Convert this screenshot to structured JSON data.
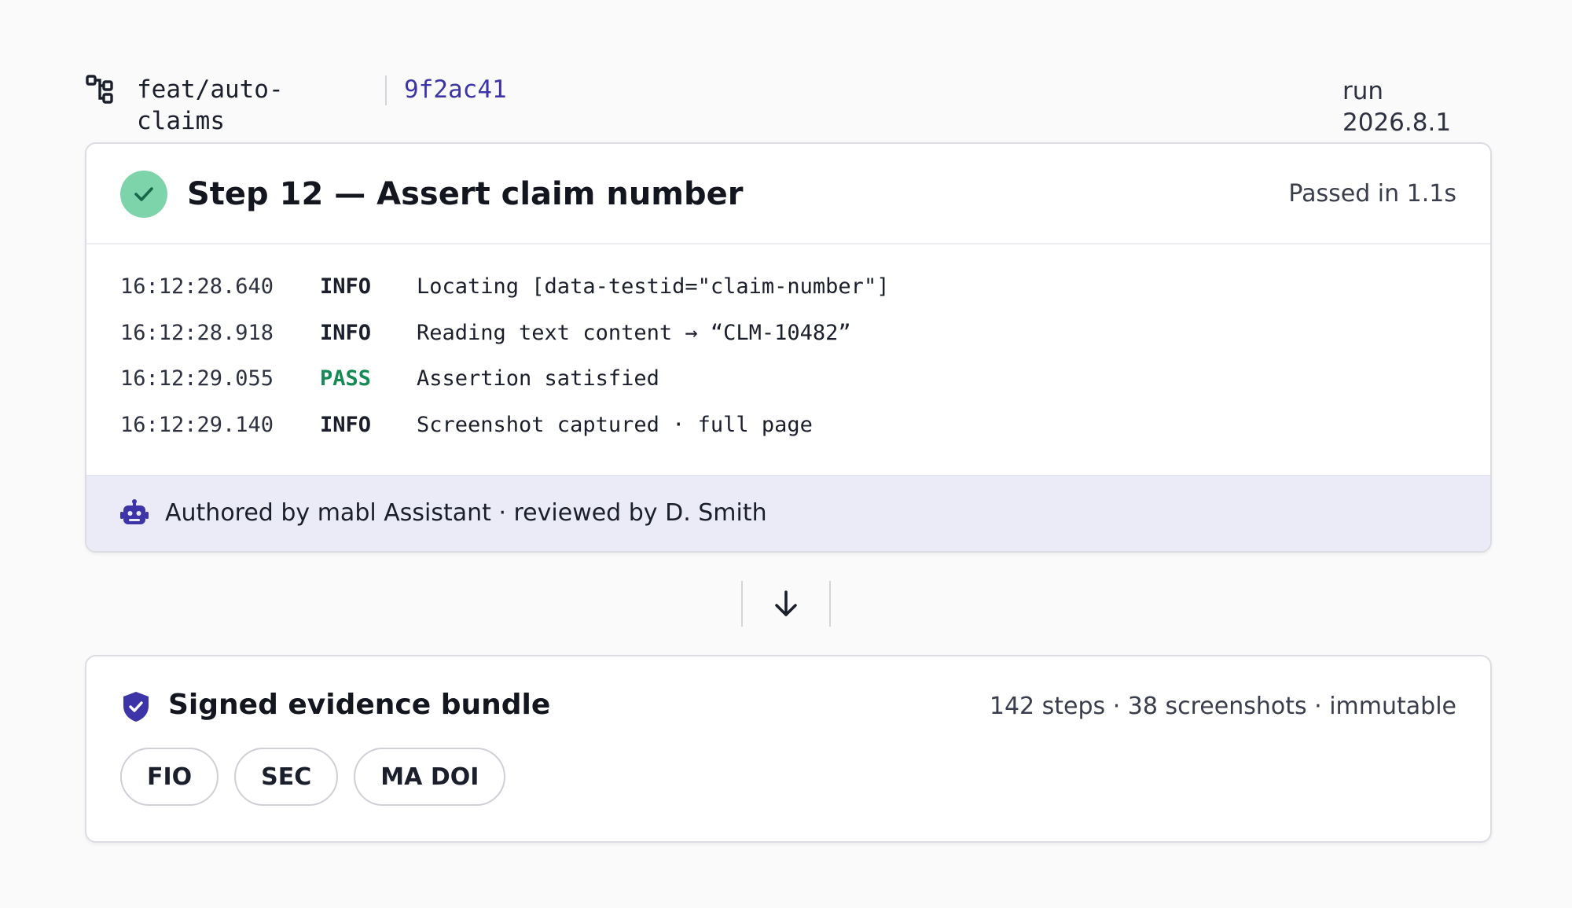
{
  "header": {
    "branch": "feat/auto-claims",
    "commit": "9f2ac41",
    "run": "run 2026.8.1"
  },
  "step": {
    "title": "Step 12 — Assert claim number",
    "status": "Passed in 1.1s",
    "log": [
      {
        "time": "16:12:28.640",
        "level": "INFO",
        "message": "Locating [data-testid=\"claim-number\"]"
      },
      {
        "time": "16:12:28.918",
        "level": "INFO",
        "message": "Reading text content → “CLM-10482”"
      },
      {
        "time": "16:12:29.055",
        "level": "PASS",
        "message": "Assertion satisfied"
      },
      {
        "time": "16:12:29.140",
        "level": "INFO",
        "message": "Screenshot captured · full page"
      }
    ],
    "author": "Authored by mabl Assistant · reviewed by D. Smith"
  },
  "evidence": {
    "title": "Signed evidence bundle",
    "meta": "142 steps · 38 screenshots · immutable",
    "tags": [
      "FIO",
      "SEC",
      "MA DOI"
    ]
  },
  "colors": {
    "accent": "#3d34a8",
    "pass": "#168a55",
    "success_circle": "#7dd3aa",
    "author_bar": "#ebebf8"
  },
  "icons": {
    "branch": "git-branch-icon",
    "status": "check-circle-icon",
    "author": "robot-icon",
    "connector": "arrow-down-icon",
    "evidence": "shield-check-icon"
  }
}
